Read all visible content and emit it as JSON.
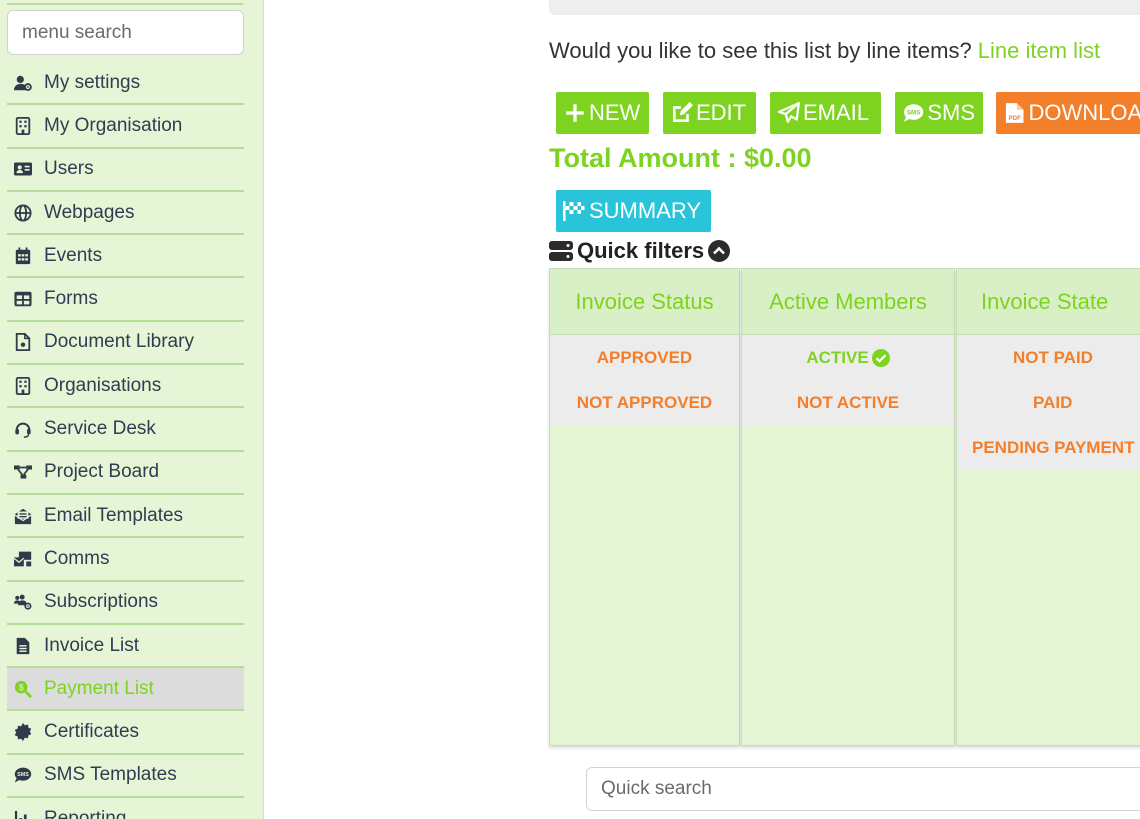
{
  "sidebar": {
    "search_placeholder": "menu search",
    "items": [
      {
        "label": "My settings",
        "icon": "user-gear-icon"
      },
      {
        "label": "My Organisation",
        "icon": "building-icon"
      },
      {
        "label": "Users",
        "icon": "id-card-icon"
      },
      {
        "label": "Webpages",
        "icon": "globe-icon"
      },
      {
        "label": "Events",
        "icon": "calendar-icon"
      },
      {
        "label": "Forms",
        "icon": "table-icon"
      },
      {
        "label": "Document Library",
        "icon": "file-icon"
      },
      {
        "label": "Organisations",
        "icon": "building-icon"
      },
      {
        "label": "Service Desk",
        "icon": "headset-icon"
      },
      {
        "label": "Project Board",
        "icon": "sitemap-icon"
      },
      {
        "label": "Email Templates",
        "icon": "envelope-open-icon"
      },
      {
        "label": "Comms",
        "icon": "mail-bulk-icon"
      },
      {
        "label": "Subscriptions",
        "icon": "users-gear-icon"
      },
      {
        "label": "Invoice List",
        "icon": "invoice-icon"
      },
      {
        "label": "Payment List",
        "icon": "search-dollar-icon",
        "active": true
      },
      {
        "label": "Certificates",
        "icon": "certificate-icon"
      },
      {
        "label": "SMS Templates",
        "icon": "sms-icon"
      },
      {
        "label": "Reporting",
        "icon": "chart-icon"
      }
    ]
  },
  "main": {
    "line_item_question": "Would you like to see this list by line items? ",
    "line_item_link": "Line item list",
    "buttons": {
      "new": "NEW",
      "edit": "EDIT",
      "email": "EMAIL",
      "sms": "SMS",
      "download": "DOWNLOAD"
    },
    "total_amount": "Total Amount : $0.00",
    "summary_button": "SUMMARY",
    "quick_filters_label": "Quick filters",
    "filters": [
      {
        "header": "Invoice Status",
        "options": [
          "APPROVED",
          "NOT APPROVED"
        ]
      },
      {
        "header": "Active Members",
        "options": [
          "ACTIVE",
          "NOT ACTIVE"
        ]
      },
      {
        "header": "Invoice State",
        "options": [
          "NOT PAID",
          "PAID",
          "PENDING PAYMENT"
        ]
      }
    ],
    "quick_search_placeholder": "Quick search"
  },
  "colors": {
    "accent_green": "#7ed321",
    "accent_orange": "#f37f2a",
    "accent_cyan": "#29c4d9",
    "sidebar_bg": "#e6f5d6"
  }
}
